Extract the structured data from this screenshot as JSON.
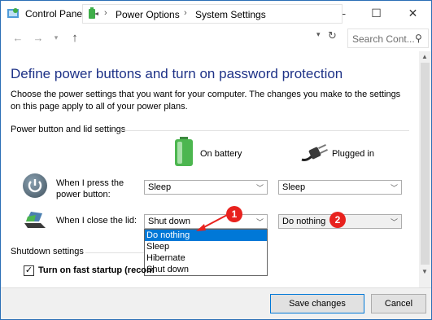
{
  "window": {
    "title": "Control Panel\\All Control Panel Items\\Power Options\\System Settings",
    "minimize": "—",
    "maximize": "☐",
    "close": "✕"
  },
  "nav": {
    "back": "←",
    "forward": "→",
    "recent": "▾",
    "up": "↑",
    "breadcrumb": [
      "Power Options",
      "System Settings"
    ],
    "separator": "›",
    "refresh": "↻",
    "search_placeholder": "Search Cont...",
    "search_icon": "⚲"
  },
  "page": {
    "heading": "Define power buttons and turn on password protection",
    "description": "Choose the power settings that you want for your computer. The changes you make to the settings on this page apply to all of your power plans.",
    "section_power": "Power button and lid settings",
    "col_battery": "On battery",
    "col_plugged": "Plugged in",
    "row_power_button": [
      "When I press the",
      "power button:"
    ],
    "row_lid": "When I close the lid:",
    "section_shutdown": "Shutdown settings",
    "fast_startup": "Turn on fast startup (recom"
  },
  "settings": {
    "power_battery": "Sleep",
    "power_plugged": "Sleep",
    "lid_battery": "Shut down",
    "lid_plugged": "Do nothing"
  },
  "dropdown_options": [
    "Do nothing",
    "Sleep",
    "Hibernate",
    "Shut down"
  ],
  "badges": [
    "1",
    "2"
  ],
  "buttons": {
    "save": "Save changes",
    "cancel": "Cancel"
  },
  "colors": {
    "accent": "#0078d7",
    "heading": "#1e3287",
    "badge": "#e8221e"
  }
}
